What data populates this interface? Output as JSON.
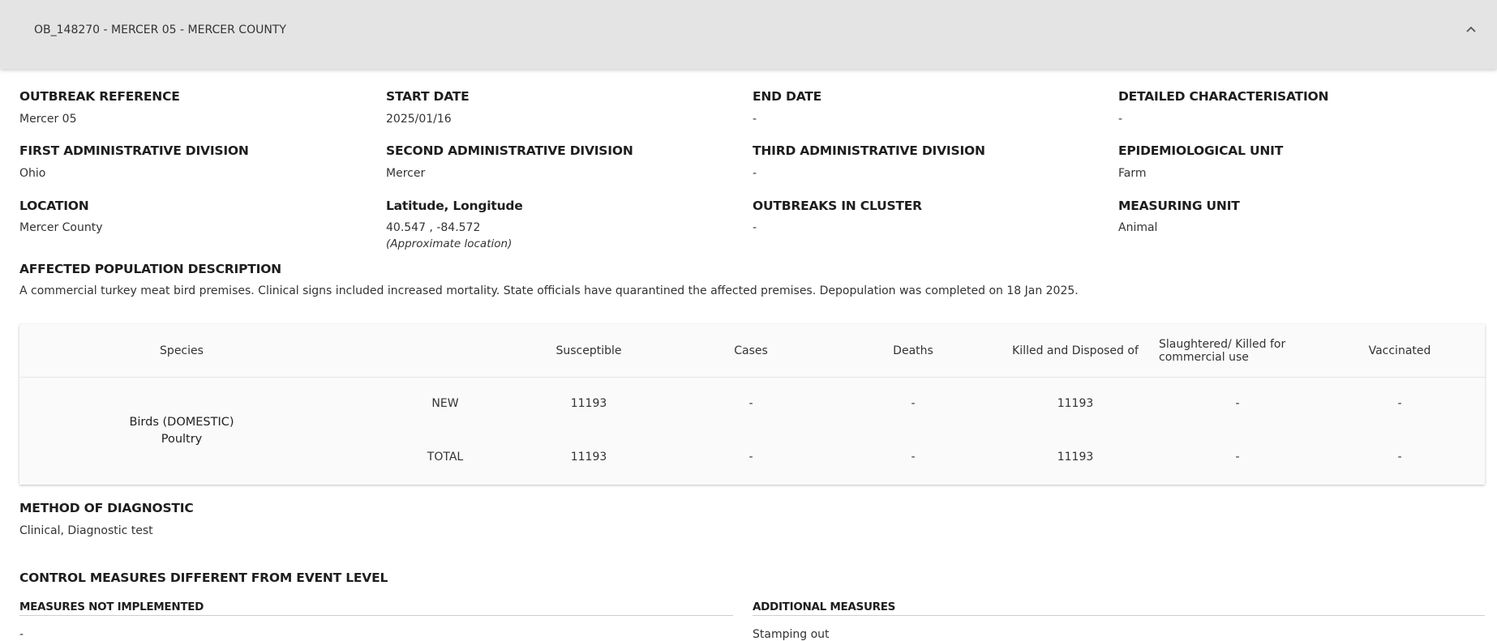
{
  "header": {
    "title": "OB_148270 - MERCER 05 - MERCER COUNTY",
    "collapse_icon": "chevron-up-icon"
  },
  "fields": {
    "outbreak_reference": {
      "label": "OUTBREAK REFERENCE",
      "value": "Mercer 05"
    },
    "start_date": {
      "label": "START DATE",
      "value": "2025/01/16"
    },
    "end_date": {
      "label": "END DATE",
      "value": "-"
    },
    "detailed_characterisation": {
      "label": "DETAILED CHARACTERISATION",
      "value": "-"
    },
    "first_admin_division": {
      "label": "FIRST ADMINISTRATIVE DIVISION",
      "value": "Ohio"
    },
    "second_admin_division": {
      "label": "SECOND ADMINISTRATIVE DIVISION",
      "value": "Mercer"
    },
    "third_admin_division": {
      "label": "THIRD ADMINISTRATIVE DIVISION",
      "value": "-"
    },
    "epidemiological_unit": {
      "label": "EPIDEMIOLOGICAL UNIT",
      "value": "Farm"
    },
    "location": {
      "label": "LOCATION",
      "value": "Mercer County"
    },
    "lat_long": {
      "label": "Latitude, Longitude",
      "value": "40.547 , -84.572",
      "note": "(Approximate location)"
    },
    "outbreaks_in_cluster": {
      "label": "OUTBREAKS IN CLUSTER",
      "value": "-"
    },
    "measuring_unit": {
      "label": "MEASURING UNIT",
      "value": "Animal"
    }
  },
  "affected_population": {
    "label": "AFFECTED POPULATION DESCRIPTION",
    "text": "A commercial turkey meat bird premises. Clinical signs included increased mortality. State officials have quarantined the affected premises. Depopulation was completed on 18 Jan 2025."
  },
  "table": {
    "headers": {
      "species": "Species",
      "susceptible": "Susceptible",
      "cases": "Cases",
      "deaths": "Deaths",
      "killed_disposed": "Killed and Disposed of",
      "slaughtered": "Slaughtered/ Killed for commercial use",
      "vaccinated": "Vaccinated"
    },
    "species_name": "Birds (DOMESTIC)",
    "species_type": "Poultry",
    "rows": [
      {
        "label": "NEW",
        "susceptible": "11193",
        "cases": "-",
        "deaths": "-",
        "killed_disposed": "11193",
        "slaughtered": "-",
        "vaccinated": "-"
      },
      {
        "label": "TOTAL",
        "susceptible": "11193",
        "cases": "-",
        "deaths": "-",
        "killed_disposed": "11193",
        "slaughtered": "-",
        "vaccinated": "-"
      }
    ]
  },
  "method_of_diagnostic": {
    "label": "METHOD OF DIAGNOSTIC",
    "value": "Clinical, Diagnostic test"
  },
  "control_measures": {
    "label": "CONTROL MEASURES DIFFERENT FROM EVENT LEVEL",
    "not_implemented": {
      "label": "MEASURES NOT IMPLEMENTED",
      "value": "-"
    },
    "additional": {
      "label": "ADDITIONAL MEASURES",
      "value": "Stamping out"
    }
  }
}
